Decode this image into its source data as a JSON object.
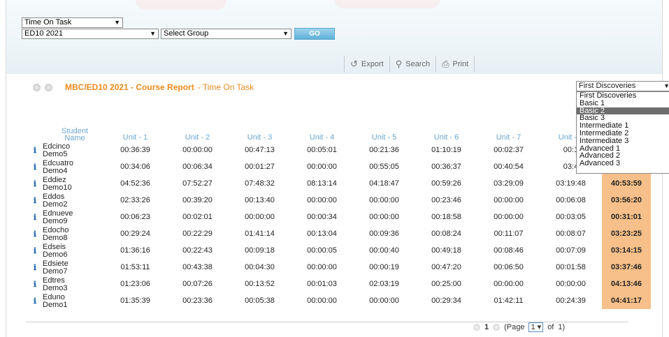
{
  "filters": {
    "report_type": "Time On Task",
    "class": "ED10 2021",
    "group": "Select Group",
    "go_label": "GO"
  },
  "toolbar": {
    "export": "Export",
    "search": "Search",
    "print": "Print"
  },
  "report": {
    "title": "MBC/ED10 2021 - Course Report",
    "subtitle": "- Time On Task"
  },
  "level_select": {
    "selected": "First Discoveries",
    "options": [
      "First Discoveries",
      "Basic 1",
      "Basic 2",
      "Basic 3",
      "Intermediate 1",
      "Intermediate 2",
      "Intermediate 3",
      "Advanced 1",
      "Advanced 2",
      "Advanced 3"
    ],
    "highlighted": "Basic 2"
  },
  "table": {
    "name_header_1": "Student",
    "name_header_2": "Name",
    "unit_headers": [
      "Unit - 1",
      "Unit - 2",
      "Unit - 3",
      "Unit - 4",
      "Unit - 5",
      "Unit - 6",
      "Unit - 7",
      "Unit - 8"
    ],
    "rows": [
      {
        "first": "Edcinco",
        "last": "Demo5",
        "units": [
          "00:36:39",
          "00:00:00",
          "00:47:13",
          "00:05:01",
          "00:21:36",
          "01:10:19",
          "00:02:37",
          "00:1"
        ],
        "total": ""
      },
      {
        "first": "Edcuatro",
        "last": "Demo4",
        "units": [
          "00:34:06",
          "00:06:34",
          "00:01:27",
          "00:00:00",
          "00:55:05",
          "00:36:37",
          "00:40:54",
          "03:4"
        ],
        "total": ""
      },
      {
        "first": "Eddiez",
        "last": "Demo10",
        "units": [
          "04:52:36",
          "07:52:27",
          "07:48:32",
          "08:13:14",
          "04:18:47",
          "00:59:26",
          "03:29:09",
          "03:19:48"
        ],
        "total": "40:53:59"
      },
      {
        "first": "Eddos",
        "last": "Demo2",
        "units": [
          "02:33:26",
          "00:39:20",
          "00:13:40",
          "00:00:00",
          "00:00:00",
          "00:23:46",
          "00:00:00",
          "00:06:08"
        ],
        "total": "03:56:20"
      },
      {
        "first": "Ednueve",
        "last": "Demo9",
        "units": [
          "00:06:23",
          "00:02:01",
          "00:00:00",
          "00:00:34",
          "00:00:00",
          "00:18:58",
          "00:00:00",
          "00:03:05"
        ],
        "total": "00:31:01"
      },
      {
        "first": "Edocho",
        "last": "Demo8",
        "units": [
          "00:29:24",
          "00:22:29",
          "01:41:14",
          "00:13:04",
          "00:09:36",
          "00:08:24",
          "00:11:07",
          "00:08:07"
        ],
        "total": "03:23:25"
      },
      {
        "first": "Edseis",
        "last": "Demo6",
        "units": [
          "01:36:16",
          "00:22:43",
          "00:09:18",
          "00:00:05",
          "00:00:40",
          "00:49:18",
          "00:08:46",
          "00:07:09"
        ],
        "total": "03:14:15"
      },
      {
        "first": "Edsiete",
        "last": "Demo7",
        "units": [
          "01:53:11",
          "00:43:38",
          "00:04:30",
          "00:00:00",
          "00:00:19",
          "00:47:20",
          "00:06:50",
          "00:01:58"
        ],
        "total": "03:37:46"
      },
      {
        "first": "Edtres",
        "last": "Demo3",
        "units": [
          "01:23:06",
          "00:07:26",
          "00:13:52",
          "00:01:03",
          "02:03:19",
          "00:25:00",
          "00:00:00",
          "00:00:00"
        ],
        "total": "04:13:46"
      },
      {
        "first": "Eduno",
        "last": "Demo1",
        "units": [
          "01:35:39",
          "00:23:36",
          "00:05:38",
          "00:00:00",
          "00:00:00",
          "00:29:34",
          "01:42:11",
          "00:24:39"
        ],
        "total": "04:41:17"
      }
    ]
  },
  "pager": {
    "current": "1",
    "page_label": "(Page",
    "page_value": "1",
    "of_label": "of",
    "total": "1)"
  }
}
